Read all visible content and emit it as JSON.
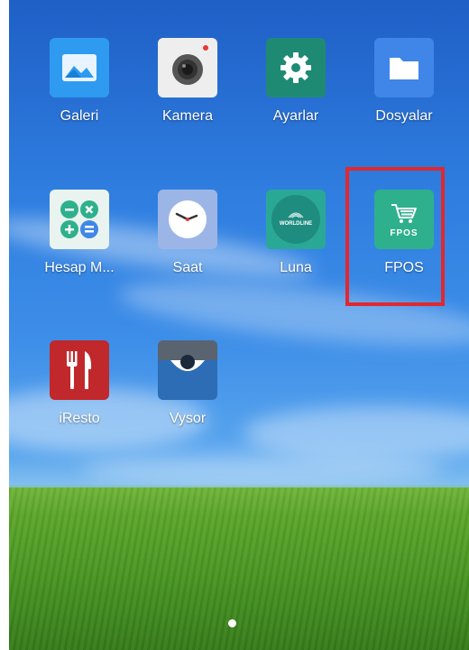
{
  "apps": [
    {
      "label": "Galeri",
      "icon": "gallery-icon",
      "color": "#2e9bf0"
    },
    {
      "label": "Kamera",
      "icon": "camera-icon",
      "color": "#eeeeee"
    },
    {
      "label": "Ayarlar",
      "icon": "settings-gear-icon",
      "color": "#1f8a73"
    },
    {
      "label": "Dosyalar",
      "icon": "folder-icon",
      "color": "#3f86e8"
    },
    {
      "label": "Hesap M...",
      "icon": "calculator-icon",
      "color": "#e9f3ef"
    },
    {
      "label": "Saat",
      "icon": "clock-icon",
      "color": "#9bb6e6"
    },
    {
      "label": "Luna",
      "icon": "luna-worldline-icon",
      "color": "#2aa896",
      "brand_text": "WORLDLINE"
    },
    {
      "label": "FPOS",
      "icon": "fpos-cart-icon",
      "color": "#2fb08c",
      "brand_text": "FPOS"
    },
    {
      "label": "iResto",
      "icon": "fork-knife-icon",
      "color": "#c0282b"
    },
    {
      "label": "Vysor",
      "icon": "vysor-eye-icon",
      "color": "#2d6db5"
    }
  ],
  "highlight": {
    "target": "FPOS",
    "color": "#e0282e"
  },
  "page_indicator": {
    "current": 1,
    "total": 1
  }
}
